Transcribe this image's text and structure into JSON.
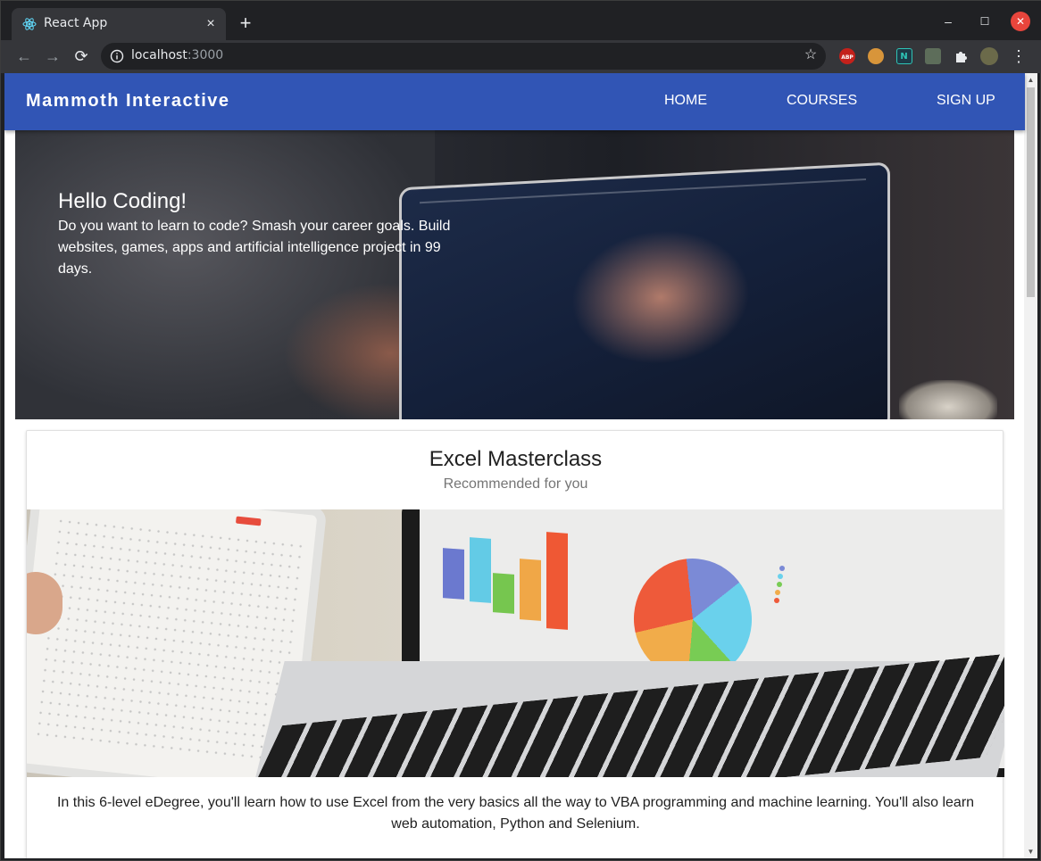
{
  "browser": {
    "tab_title": "React App",
    "url_host": "localhost",
    "url_port": ":3000",
    "buttons": {
      "new_tab": "+",
      "close_tab": "×",
      "minimize": "–",
      "maximize": "☐",
      "close_window": "✕",
      "back": "←",
      "forward": "→",
      "reload": "⟳",
      "bookmark": "☆",
      "menu": "⋮"
    },
    "extensions": [
      "adblock-icon",
      "cookie-icon",
      "n-icon",
      "extension-icon",
      "puzzle-icon",
      "profile-avatar"
    ]
  },
  "appbar": {
    "brand": "Mammoth Interactive",
    "nav": [
      "HOME",
      "COURSES",
      "SIGN UP"
    ],
    "color": "#3155b5"
  },
  "hero": {
    "title": "Hello Coding!",
    "text": "Do you want to learn to code? Smash your career goals. Build websites, games, apps and artificial intelligence project in 99 days."
  },
  "card": {
    "title": "Excel Masterclass",
    "subtitle": "Recommended for you",
    "description": "In this 6-level eDegree, you'll learn how to use Excel from the very basics all the way to VBA programming and machine learning. You'll also learn web automation, Python and Selenium."
  },
  "colors": {
    "scrollbar_thumb": "#c1c1c1",
    "window_close": "#e8453c"
  }
}
